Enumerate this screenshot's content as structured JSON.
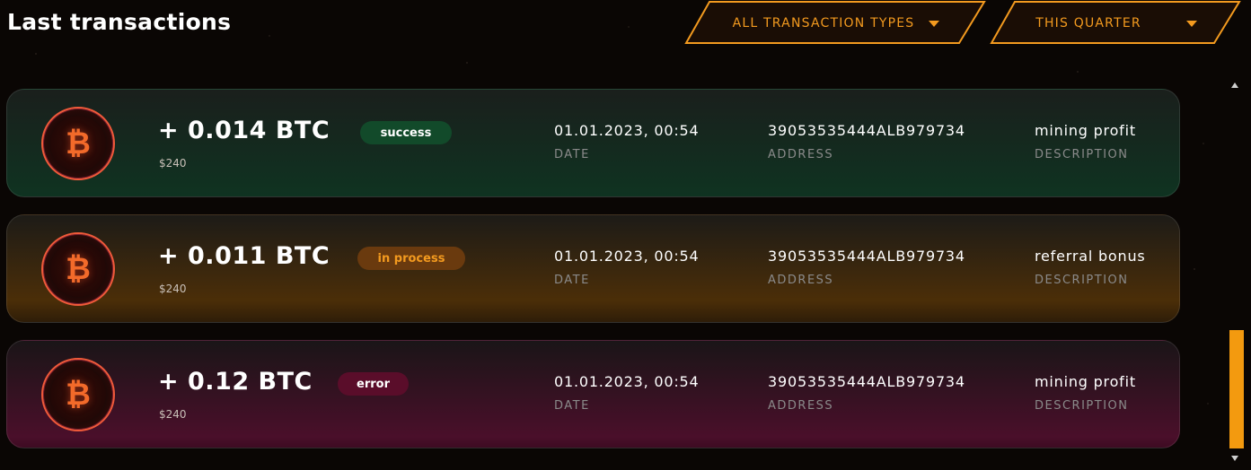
{
  "header": {
    "title": "Last transactions",
    "filters": [
      {
        "label": "ALL TRANSACTION TYPES"
      },
      {
        "label": "THIS QUARTER"
      }
    ]
  },
  "labels": {
    "date": "DATE",
    "address": "ADDRESS",
    "description": "DESCRIPTION"
  },
  "coin_symbol": "₿",
  "colors": {
    "accent": "#f39a1f",
    "success": "#124a2a",
    "in_process": "#6a3a0e",
    "error": "#5a0d2a",
    "scrollbar_thumb": "#f39a0f"
  },
  "transactions": [
    {
      "amount": "+ 0.014 BTC",
      "usd": "$240",
      "status": "success",
      "date": "01.01.2023, 00:54",
      "address": "39053535444ALB979734",
      "description": "mining profit"
    },
    {
      "amount": "+ 0.011 BTC",
      "usd": "$240",
      "status": "in process",
      "date": "01.01.2023, 00:54",
      "address": "39053535444ALB979734",
      "description": "referral bonus"
    },
    {
      "amount": "+ 0.12 BTC",
      "usd": "$240",
      "status": "error",
      "date": "01.01.2023, 00:54",
      "address": "39053535444ALB979734",
      "description": "mining profit"
    }
  ]
}
